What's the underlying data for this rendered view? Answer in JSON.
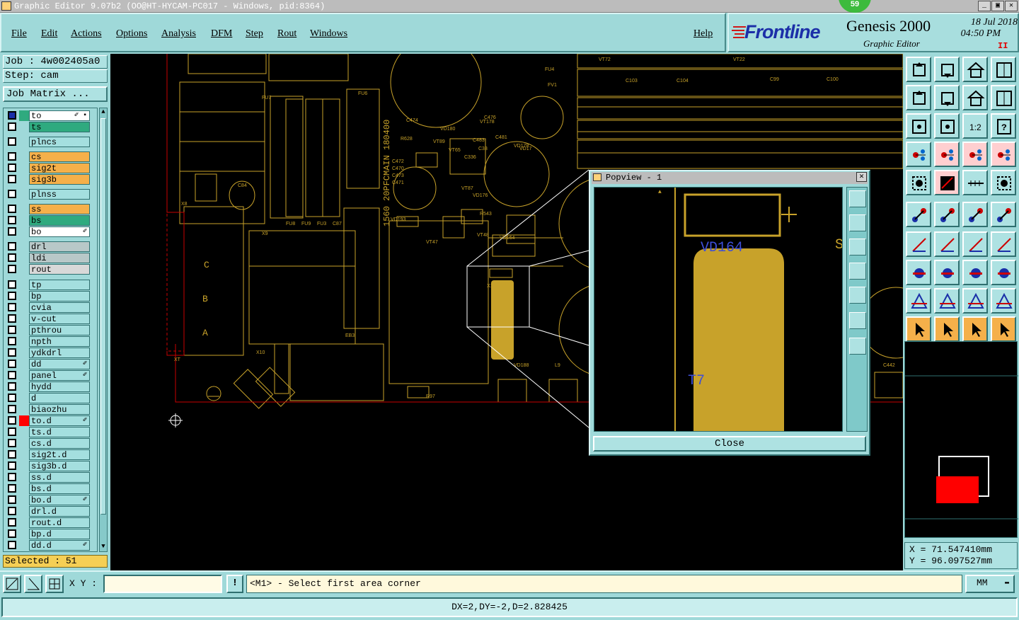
{
  "window": {
    "title": "Graphic Editor 9.07b2 (OO@HT-HYCAM-PC017 - Windows, pid:8364)",
    "notification_count": "59"
  },
  "menu": {
    "items": [
      "File",
      "Edit",
      "Actions",
      "Options",
      "Analysis",
      "DFM",
      "Step",
      "Rout",
      "Windows"
    ],
    "help": "Help"
  },
  "brand": {
    "logo": "Frontline",
    "product": "Genesis 2000",
    "subtitle": "Graphic Editor",
    "date": "18 Jul 2018",
    "time": "04:50 PM",
    "pause": "II"
  },
  "job": {
    "job_label": "Job : 4w002405a0",
    "step_label": "Step: cam",
    "matrix_button": "Job Matrix ..."
  },
  "layers": [
    {
      "name": "to",
      "color": "#ffffff",
      "active": true,
      "mark": "✐ ▪"
    },
    {
      "name": "ts",
      "color": "#2faa7f"
    },
    {
      "name": "plncs",
      "color": "#a4dfdf"
    },
    {
      "name": "cs",
      "color": "#f5b04a"
    },
    {
      "name": "sig2t",
      "color": "#f5b04a"
    },
    {
      "name": "sig3b",
      "color": "#f5b04a"
    },
    {
      "name": "plnss",
      "color": "#a4dfdf"
    },
    {
      "name": "ss",
      "color": "#f5b04a"
    },
    {
      "name": "bs",
      "color": "#2faa7f"
    },
    {
      "name": "bo",
      "color": "#ffffff",
      "mark": "✐"
    },
    {
      "name": "drl",
      "color": "#b8c8c8"
    },
    {
      "name": "ldi",
      "color": "#b8c8c8"
    },
    {
      "name": "rout",
      "color": "#d8d8d8"
    },
    {
      "name": "tp",
      "color": "#a4dfdf"
    },
    {
      "name": "bp",
      "color": "#a4dfdf"
    },
    {
      "name": "cvia",
      "color": "#a4dfdf"
    },
    {
      "name": "v-cut",
      "color": "#a4dfdf"
    },
    {
      "name": "pthrou",
      "color": "#a4dfdf"
    },
    {
      "name": "npth",
      "color": "#a4dfdf"
    },
    {
      "name": "ydkdrl",
      "color": "#a4dfdf"
    },
    {
      "name": "dd",
      "color": "#a4dfdf",
      "mark": "✐"
    },
    {
      "name": "panel",
      "color": "#a4dfdf",
      "mark": "✐"
    },
    {
      "name": "hydd",
      "color": "#a4dfdf"
    },
    {
      "name": "d",
      "color": "#a4dfdf"
    },
    {
      "name": "biaozhu",
      "color": "#a4dfdf"
    },
    {
      "name": "to.d",
      "color": "#a4dfdf",
      "swatch": "#ff0000",
      "mark": "✐"
    },
    {
      "name": "ts.d",
      "color": "#a4dfdf"
    },
    {
      "name": "cs.d",
      "color": "#a4dfdf"
    },
    {
      "name": "sig2t.d",
      "color": "#a4dfdf"
    },
    {
      "name": "sig3b.d",
      "color": "#a4dfdf"
    },
    {
      "name": "ss.d",
      "color": "#a4dfdf"
    },
    {
      "name": "bs.d",
      "color": "#a4dfdf"
    },
    {
      "name": "bo.d",
      "color": "#a4dfdf",
      "mark": "✐"
    },
    {
      "name": "drl.d",
      "color": "#a4dfdf"
    },
    {
      "name": "rout.d",
      "color": "#a4dfdf"
    },
    {
      "name": "bp.d",
      "color": "#a4dfdf"
    },
    {
      "name": "dd.d",
      "color": "#a4dfdf",
      "mark": "✐"
    }
  ],
  "selected": "Selected : 51",
  "canvas_labels": {
    "board_text": "1560 20PFCMAIN 180400",
    "c": "C",
    "b": "B",
    "a": "A",
    "parts": [
      "VT72",
      "VT22",
      "C103",
      "C104",
      "C99",
      "C100",
      "C474",
      "R628",
      "C472",
      "C470",
      "C473",
      "C471",
      "C476",
      "C481",
      "VD180",
      "VT89",
      "VT178",
      "C483",
      "VD17",
      "VT65",
      "C336",
      "VD178",
      "VT87",
      "VD176",
      "R543",
      "VD193",
      "VT48",
      "VD164",
      "VT47",
      "T17",
      "X1",
      "FV1",
      "C33",
      "C84",
      "X8",
      "X9",
      "X10",
      "XT",
      "VD188",
      "L9",
      "C442",
      "R97",
      "FU4",
      "FU6",
      "FU7",
      "FU8",
      "FU9",
      "FU3",
      "C87",
      "EB3"
    ]
  },
  "popview": {
    "title": "Popview - 1",
    "close": "Close",
    "label_vd": "VD164",
    "label_t": "T7",
    "label_s": "S"
  },
  "coords": {
    "x": "X = 71.547410mm",
    "y": "Y = 96.097527mm"
  },
  "bottom": {
    "xy_label": "X Y :",
    "xy_value": "",
    "info_icon": "!",
    "prompt": "<M1> - Select first area corner",
    "units": "MM"
  },
  "status": "DX=2,DY=-2,D=2.828425",
  "icons": {
    "toolbar": [
      "layer-up-icon",
      "layer-down-icon",
      "home-icon",
      "window-icon",
      "snap-left-icon",
      "snap-right-icon",
      "resize-icon",
      "swap-icon",
      "zoom-fit-icon",
      "zoom-center-icon",
      "scale-1-2-icon",
      "help-icon",
      "measure-icon",
      "pin-icon",
      "feature-filter-icon",
      "feature-select-icon",
      "cursor-box-icon",
      "draw-line-icon",
      "ruler-icon",
      "circle-icon",
      "node-icon",
      "cross-icon",
      "dot-line-icon",
      "dot-diag-icon",
      "angle-icon",
      "line-icon",
      "arc-icon",
      "flip-icon",
      "marker-icon",
      "segment-icon",
      "dimension-icon",
      "cluster-icon",
      "triangle-icon",
      "triangle-a-icon",
      "triangle-b-icon",
      "triangle-c-icon",
      "pointer-icon",
      "pointer-box-icon",
      "pointer-frame-icon",
      "route-icon"
    ]
  },
  "colors": {
    "accent": "#9fd9d9",
    "board": "#c8a22a",
    "outline": "#c00000",
    "highlight": "#ff0000",
    "text_blue": "#3e4fd8"
  }
}
